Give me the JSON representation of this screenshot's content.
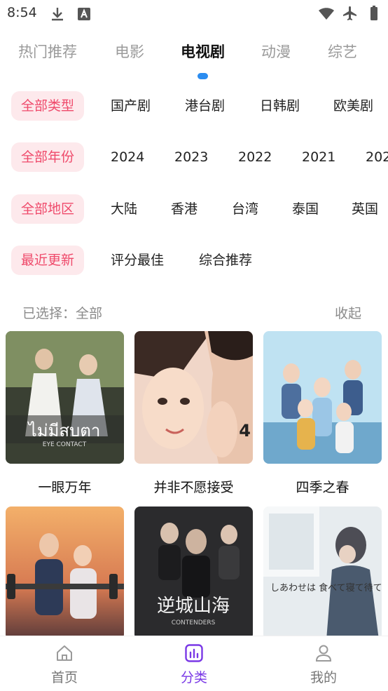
{
  "status_bar": {
    "time": "8:54"
  },
  "tabs": [
    {
      "label": "热门推荐",
      "active": false
    },
    {
      "label": "电影",
      "active": false
    },
    {
      "label": "电视剧",
      "active": true
    },
    {
      "label": "动漫",
      "active": false
    },
    {
      "label": "综艺",
      "active": false
    }
  ],
  "filters": {
    "type": [
      "全部类型",
      "国产剧",
      "港台剧",
      "日韩剧",
      "欧美剧"
    ],
    "year": [
      "全部年份",
      "2024",
      "2023",
      "2022",
      "2021",
      "202"
    ],
    "region": [
      "全部地区",
      "大陆",
      "香港",
      "台湾",
      "泰国",
      "英国"
    ],
    "sort": [
      "最近更新",
      "评分最佳",
      "综合推荐"
    ]
  },
  "selected": {
    "text": "已选择：全部",
    "collapse": "收起"
  },
  "posters": [
    {
      "title": "一眼万年",
      "logo_text": "EYE CONTACT"
    },
    {
      "title": "并非不愿接受",
      "logo_text": "4"
    },
    {
      "title": "四季之春",
      "logo_text": ""
    },
    {
      "title": "",
      "logo_text": ""
    },
    {
      "title": "",
      "logo_text": "CONTENDERS"
    },
    {
      "title": "",
      "logo_text": "しあわせは 食べて寝て待て"
    }
  ],
  "bottom_nav": [
    {
      "label": "首页",
      "active": false
    },
    {
      "label": "分类",
      "active": true
    },
    {
      "label": "我的",
      "active": false
    }
  ],
  "colors": {
    "accent_pink": "#ef4a6b",
    "chip_bg": "#fde9ec",
    "indicator_blue": "#2b8cf0",
    "nav_active": "#7a39e6"
  }
}
